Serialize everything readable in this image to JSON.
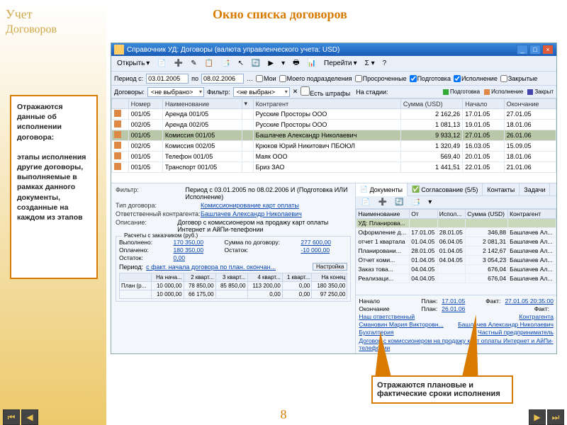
{
  "slide": {
    "title": "Окно списка договоров",
    "sidebar_title": "Учет",
    "sidebar_sub": "Договоров",
    "page_number": "8"
  },
  "callout1": {
    "line1": "Отражаются данные об исполнении договора:",
    "line2": "этапы исполнения другие договоры, выполняемые в рамках данного документы, созданные на каждом из этапов"
  },
  "callout2": "Отражаются плановые и фактические сроки исполнения",
  "window": {
    "title": "Справочник УД: Договоры (валюта управленческого учета: USD)",
    "open_btn": "Открыть",
    "jump_btn": "Перейти"
  },
  "filter": {
    "period_lbl": "Период с:",
    "from": "03.01.2005",
    "to_lbl": "по",
    "to": "08.02.2006",
    "moi": "Мои",
    "moego": "Моего подразделения",
    "prosr": "Просроченные",
    "podg": "Подготовка",
    "ispoln": "Исполнение",
    "zakr": "Закрытые"
  },
  "filter2": {
    "dog_lbl": "Договоры:",
    "dog_val": "<не выбрано>",
    "filter_lbl": "Фильтр:",
    "filter_val": "<не выбран>",
    "shtraf": "Есть штрафы",
    "stage_lbl": "На стадии:",
    "l1": "Подготовка",
    "l2": "Исполнение",
    "l3": "Закрыт"
  },
  "columns": [
    "",
    "Номер",
    "Наименование",
    "▾",
    "Контрагент",
    "Сумма (USD)",
    "Начало",
    "Окончание"
  ],
  "rows": [
    {
      "n": "001/05",
      "name": "Аренда 001/05",
      "k": "Русские Просторы ООО",
      "s": "2 162,26",
      "b": "17.01.05",
      "e": "27.01.05"
    },
    {
      "n": "002/05",
      "name": "Аренда 002/05",
      "k": "Русские Просторы ООО",
      "s": "1 081,13",
      "b": "19.01.05",
      "e": "18.01.06"
    },
    {
      "n": "001/05",
      "name": "Комиссия 001/05",
      "k": "Башлачев Александр Николаевич",
      "s": "9 933,12",
      "b": "27.01.05",
      "e": "26.01.06",
      "sel": true
    },
    {
      "n": "002/05",
      "name": "Комиссия 002/05",
      "k": "Крюков Юрий Никитович ПБОЮЛ",
      "s": "1 320,49",
      "b": "16.03.05",
      "e": "15.09.05"
    },
    {
      "n": "001/05",
      "name": "Телефон 001/05",
      "k": "Маяк ООО",
      "s": "569,40",
      "b": "20.01.05",
      "e": "18.01.06"
    },
    {
      "n": "001/05",
      "name": "Транспорт 001/05",
      "k": "Бриз ЗАО",
      "s": "1 441,51",
      "b": "22.01.05",
      "e": "21.01.06"
    }
  ],
  "detail": {
    "filter_lbl": "Фильтр:",
    "filter_val": "Период с 03.01.2005 по 08.02.2006 И (Подготовка ИЛИ Исполнение)",
    "type_lbl": "Тип договора:",
    "type_val": "Комиссионирование карт оплаты",
    "resp_lbl": "Ответственный контрагента:",
    "resp_val": "Башлачев Александр Николаевич",
    "desc_lbl": "Описание:",
    "desc_val": "Договор с комиссионером на продажу карт оплаты Интернет и АйПи-телефонии"
  },
  "calc": {
    "title": "Расчеты с заказчиком (руб.)",
    "vyp_lbl": "Выполнено:",
    "vyp": "170 350,00",
    "sum_lbl": "Сумма по договору:",
    "sum": "277 600,00",
    "opl_lbl": "Оплачено:",
    "opl": "180 350,00",
    "ost2_lbl": "Остаток:",
    "ost2": "-10 000,00",
    "ost_lbl": "Остаток:",
    "ost": "0,00",
    "per_lbl": "Период:",
    "per_val": "с факт. начала договора по план. окончан...",
    "nastr": "Настройка"
  },
  "plan": {
    "cols": [
      "",
      "На нача...",
      "2 кварт...",
      "3 кварт...",
      "4 кварт...",
      "1 кварт...",
      "На конец"
    ],
    "r1": [
      "План (р...",
      "10 000,00",
      "78 850,00",
      "85 850,00",
      "113 200,00",
      "0,00",
      "180 350,00"
    ],
    "r2": [
      "",
      "10 000,00",
      "66 175,00",
      "",
      "0,00",
      "0,00",
      "97 250,00"
    ]
  },
  "tabs": {
    "t1": "Документы",
    "t2": "Согласование (5/5)",
    "t3": "Контакты",
    "t4": "Задачи"
  },
  "docs": {
    "cols": [
      "Наименование",
      "От",
      "Испол...",
      "Сумма (USD)",
      "Контрагент"
    ],
    "rows": [
      {
        "n": "УД: Планирова...",
        "d": "",
        "i": "",
        "s": "",
        "k": "",
        "sel": true
      },
      {
        "n": "Оформление д...",
        "d": "17.01.05",
        "i": "28.01.05",
        "s": "346,88",
        "k": "Башлачев Ал..."
      },
      {
        "n": "отчет 1 квартала",
        "d": "01.04.05",
        "i": "06.04.05",
        "s": "2 081,31",
        "k": "Башлачев Ал..."
      },
      {
        "n": "Планировани...",
        "d": "28.01.05",
        "i": "01.04.05",
        "s": "2 142,67",
        "k": "Башлачев Ал..."
      },
      {
        "n": "Отчет коми...",
        "d": "01.04.05",
        "i": "04.04.05",
        "s": "3 054,23",
        "k": "Башлачев Ал..."
      },
      {
        "n": "Заказ това...",
        "d": "04.04.05",
        "i": "",
        "s": "676,04",
        "k": "Башлачев Ал..."
      },
      {
        "n": "Реализаци...",
        "d": "04.04.05",
        "i": "",
        "s": "676,04",
        "k": "Башлачев Ал..."
      }
    ]
  },
  "dates": {
    "nach": "Начало",
    "plan": "План:",
    "p1": "17.01.05",
    "fakt": "Факт:",
    "f1": "27.01.05 20:35:00",
    "okon": "Окончание",
    "p2": "26.01.06",
    "f2": "",
    "row3l": "Наш ответственный",
    "row3r": "Контрагента",
    "resp1": "Смановин Мария Викторовн...",
    "resp2": "Башлачев Александр Николаевич",
    "row4l": "Бухгалтерия",
    "row4r": "Частный предприниматель",
    "foot": "Договор с комиссионером на продажу карт оплаты Интернет и АйПи-телефонии"
  }
}
